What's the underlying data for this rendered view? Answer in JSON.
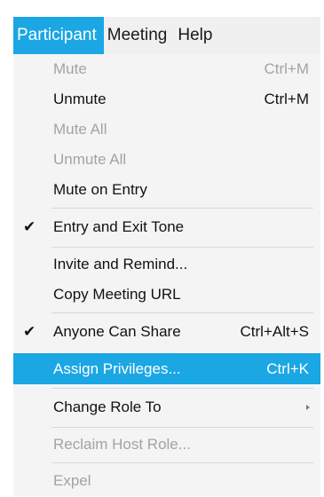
{
  "menubar": {
    "participant": "Participant",
    "meeting": "Meeting",
    "help": "Help"
  },
  "menu": {
    "mute": {
      "label": "Mute",
      "shortcut": "Ctrl+M"
    },
    "unmute": {
      "label": "Unmute",
      "shortcut": "Ctrl+M"
    },
    "mute_all": {
      "label": "Mute All"
    },
    "unmute_all": {
      "label": "Unmute All"
    },
    "mute_on_entry": {
      "label": "Mute on Entry"
    },
    "entry_exit_tone": {
      "label": "Entry and Exit Tone",
      "check": "✔"
    },
    "invite_remind": {
      "label": "Invite and Remind..."
    },
    "copy_url": {
      "label": "Copy Meeting URL"
    },
    "anyone_can_share": {
      "label": "Anyone Can Share",
      "shortcut": "Ctrl+Alt+S",
      "check": "✔"
    },
    "assign_privileges": {
      "label": "Assign Privileges...",
      "shortcut": "Ctrl+K"
    },
    "change_role": {
      "label": "Change Role To"
    },
    "reclaim_host": {
      "label": "Reclaim Host Role..."
    },
    "expel": {
      "label": "Expel"
    }
  },
  "colors": {
    "accent": "#1ba6e4",
    "disabled_text": "#a3a3a3",
    "menu_bg": "#f4f4f4"
  },
  "icons": {
    "check": "checkmark-icon",
    "submenu": "submenu-arrow-icon"
  }
}
